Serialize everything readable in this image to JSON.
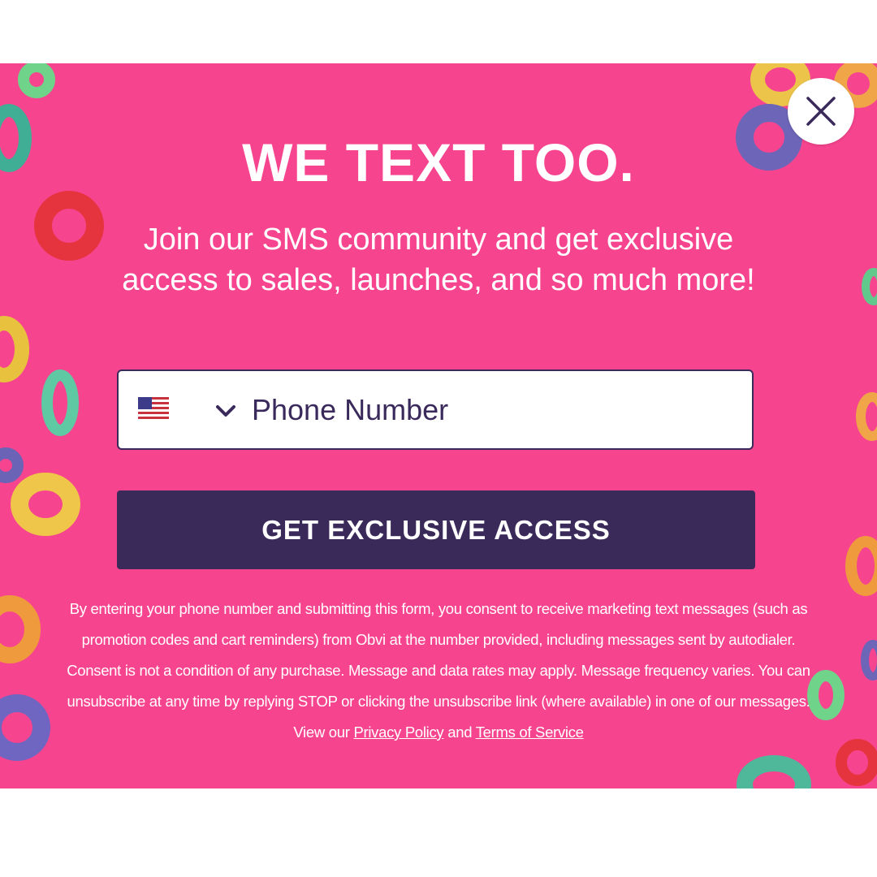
{
  "popup": {
    "headline": "WE TEXT TOO.",
    "subtext": "Join our SMS community and get exclusive access to sales, launches, and so much more!",
    "phone": {
      "country_flag": "us-flag-icon",
      "placeholder": "Phone Number",
      "value": ""
    },
    "cta_label": "GET EXCLUSIVE ACCESS",
    "legal": {
      "text": "By entering your phone number and submitting this form, you consent to receive marketing text messages (such as promotion codes and cart reminders) from Obvi at the number provided, including messages sent by autodialer. Consent is not a condition of any purchase. Message and data rates may apply. Message frequency varies. You can unsubscribe at any time by replying STOP or clicking the unsubscribe link (where available) in one of our messages. View our ",
      "privacy_link": "Privacy Policy",
      "and": " and ",
      "terms_link": "Terms of Service"
    },
    "close_icon": "close-icon"
  },
  "colors": {
    "background": "#f7448f",
    "button": "#3a2a5a",
    "text": "#ffffff",
    "input_text": "#3a2a5c"
  }
}
